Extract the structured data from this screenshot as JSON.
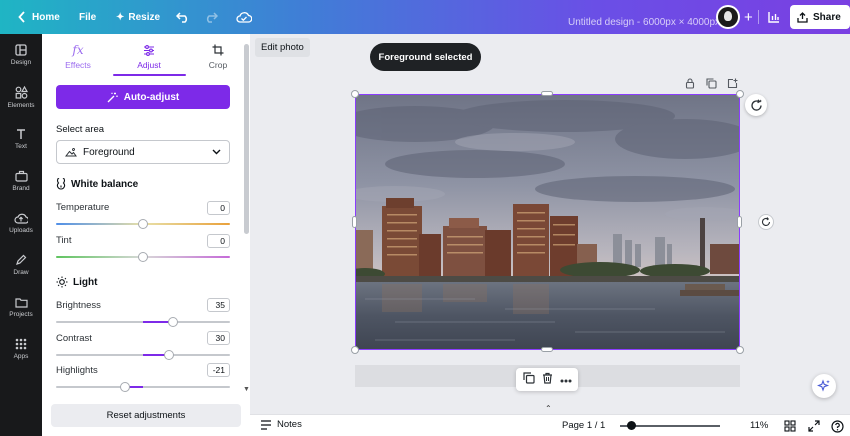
{
  "topbar": {
    "home_label": "Home",
    "file_label": "File",
    "resize_label": "Resize",
    "design_title": "Untitled design - 6000px × 4000px",
    "share_label": "Share",
    "plus_glyph": "+"
  },
  "rail": {
    "items": [
      {
        "label": "Design",
        "icon": "design-icon"
      },
      {
        "label": "Elements",
        "icon": "elements-icon"
      },
      {
        "label": "Text",
        "icon": "text-icon"
      },
      {
        "label": "Brand",
        "icon": "brand-icon"
      },
      {
        "label": "Uploads",
        "icon": "uploads-icon"
      },
      {
        "label": "Draw",
        "icon": "draw-icon"
      },
      {
        "label": "Projects",
        "icon": "projects-icon"
      },
      {
        "label": "Apps",
        "icon": "apps-icon"
      }
    ]
  },
  "panel": {
    "tabs": [
      {
        "label": "Effects",
        "icon": "fx-icon"
      },
      {
        "label": "Adjust",
        "icon": "sliders-icon",
        "active": true
      },
      {
        "label": "Crop",
        "icon": "crop-icon"
      }
    ],
    "effects_glyph": "fx",
    "auto_adjust_label": "Auto-adjust",
    "select_area_label": "Select area",
    "select_area_value": "Foreground",
    "white_balance_label": "White balance",
    "light_label": "Light",
    "sliders": [
      {
        "label": "Temperature",
        "value": "0",
        "numeric": 0
      },
      {
        "label": "Tint",
        "value": "0",
        "numeric": 0
      },
      {
        "label": "Brightness",
        "value": "35",
        "numeric": 35
      },
      {
        "label": "Contrast",
        "value": "30",
        "numeric": 30
      },
      {
        "label": "Highlights",
        "value": "-21",
        "numeric": -21
      }
    ],
    "slider_range": [
      -100,
      100
    ],
    "reset_label": "Reset adjustments"
  },
  "editor": {
    "edit_photo_label": "Edit photo",
    "toast_label": "Foreground selected"
  },
  "bottombar": {
    "notes_label": "Notes",
    "page_indicator": "Page 1 / 1",
    "zoom_label": "11%",
    "zoom_fraction": 0.11
  },
  "colors": {
    "accent": "#7d2ae8",
    "rail_bg": "#18191b",
    "canvas_bg": "#ebecf0"
  }
}
